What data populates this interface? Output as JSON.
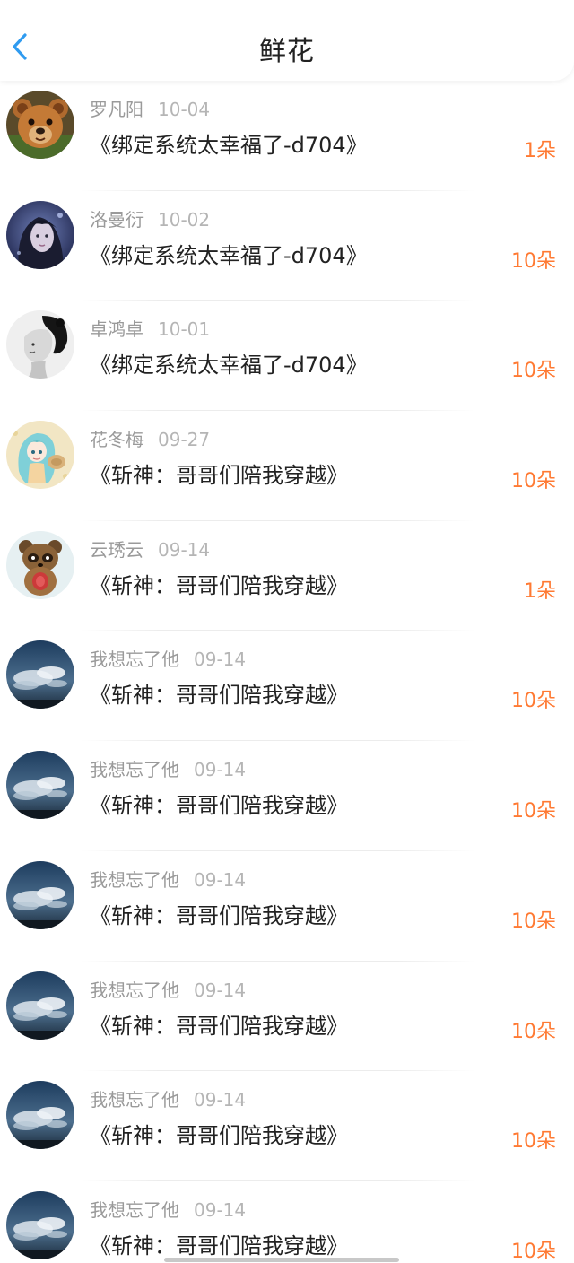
{
  "header": {
    "title": "鲜花",
    "back_icon": "chevron-left-icon",
    "accent_color": "#2f9bf0"
  },
  "colors": {
    "count": "#ff7a33",
    "name": "#9a9a9a",
    "title": "#222222"
  },
  "items": [
    {
      "name": "罗凡阳",
      "date": "10-04",
      "book": "《绑定系统太幸福了-d704》",
      "count": "1朵",
      "avatar": "brown-teddy-bear-avatar"
    },
    {
      "name": "洛曼衍",
      "date": "10-02",
      "book": "《绑定系统太幸福了-d704》",
      "count": "10朵",
      "avatar": "dark-haired-girl-avatar"
    },
    {
      "name": "卓鸿卓",
      "date": "10-01",
      "book": "《绑定系统太幸福了-d704》",
      "count": "10朵",
      "avatar": "monochrome-woman-avatar"
    },
    {
      "name": "花冬梅",
      "date": "09-27",
      "book": "《斩神：哥哥们陪我穿越》",
      "count": "10朵",
      "avatar": "anime-girl-avatar"
    },
    {
      "name": "云琇云",
      "date": "09-14",
      "book": "《斩神：哥哥们陪我穿越》",
      "count": "1朵",
      "avatar": "raccoon-avatar"
    },
    {
      "name": "我想忘了他",
      "date": "09-14",
      "book": "《斩神：哥哥们陪我穿越》",
      "count": "10朵",
      "avatar": "cloudy-sky-avatar"
    },
    {
      "name": "我想忘了他",
      "date": "09-14",
      "book": "《斩神：哥哥们陪我穿越》",
      "count": "10朵",
      "avatar": "cloudy-sky-avatar"
    },
    {
      "name": "我想忘了他",
      "date": "09-14",
      "book": "《斩神：哥哥们陪我穿越》",
      "count": "10朵",
      "avatar": "cloudy-sky-avatar"
    },
    {
      "name": "我想忘了他",
      "date": "09-14",
      "book": "《斩神：哥哥们陪我穿越》",
      "count": "10朵",
      "avatar": "cloudy-sky-avatar"
    },
    {
      "name": "我想忘了他",
      "date": "09-14",
      "book": "《斩神：哥哥们陪我穿越》",
      "count": "10朵",
      "avatar": "cloudy-sky-avatar"
    },
    {
      "name": "我想忘了他",
      "date": "09-14",
      "book": "《斩神：哥哥们陪我穿越》",
      "count": "10朵",
      "avatar": "cloudy-sky-avatar"
    }
  ]
}
